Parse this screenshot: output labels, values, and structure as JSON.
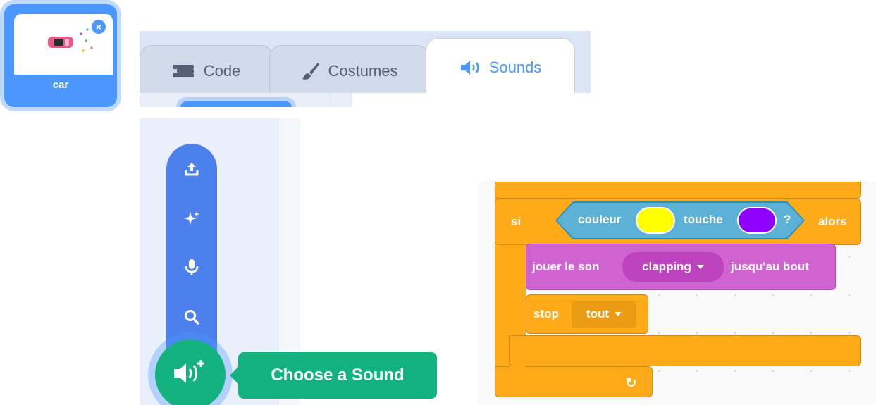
{
  "sprite": {
    "name": "car",
    "delete_glyph": "×"
  },
  "tabs": [
    {
      "label": "Code",
      "icon": "code-icon",
      "active": false
    },
    {
      "label": "Costumes",
      "icon": "brush-icon",
      "active": false
    },
    {
      "label": "Sounds",
      "icon": "speaker-icon",
      "active": true
    }
  ],
  "sound_menu": {
    "items": [
      "upload-icon",
      "sparkle-icon",
      "microphone-icon",
      "search-icon"
    ],
    "main_button_icon": "speaker-add-icon",
    "tooltip": "Choose a Sound"
  },
  "script": {
    "if_block": {
      "if_label": "si",
      "condition": {
        "label_color": "couleur",
        "label_touch": "touche",
        "question": "?",
        "color_1": "#ffff00",
        "color_2": "#8f00ff"
      },
      "then_label": "alors"
    },
    "play_sound": {
      "label": "jouer le son",
      "sound": "clapping",
      "suffix": "jusqu'au bout"
    },
    "stop": {
      "label": "stop",
      "option": "tout"
    },
    "loop_arrow": "↻"
  },
  "colors": {
    "accent": "#4c97ff",
    "menu_blue": "#4c80ec",
    "green": "#14b27f",
    "control": "#ffab19",
    "sensing": "#5cb1d6",
    "sound": "#cf63cf"
  }
}
